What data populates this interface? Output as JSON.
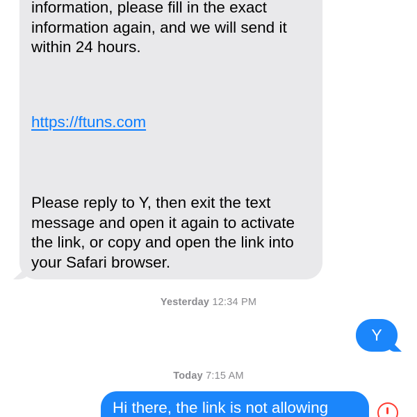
{
  "incoming_message": {
    "paragraph_1": "information, please fill in the exact information again, and we will send it within 24 hours.",
    "link": "https://ftuns.com",
    "paragraph_2": "Please reply to Y, then exit the text message and open it again to activate the link, or copy and open the link into your Safari browser."
  },
  "timestamps": [
    {
      "day": "Yesterday",
      "time": "12:34 PM"
    },
    {
      "day": "Today",
      "time": "7:15 AM"
    }
  ],
  "outgoing_messages": [
    {
      "text": "Y"
    },
    {
      "text": "Hi there, the link is not allowing"
    }
  ],
  "status": {
    "error_icon": "exclamation-circle-icon",
    "error_color": "#ff3b30"
  },
  "colors": {
    "incoming_bubble": "#e9e9eb",
    "outgoing_bubble": "#1b86fb",
    "link": "#0a7cff",
    "timestamp": "#8a8a8e"
  }
}
